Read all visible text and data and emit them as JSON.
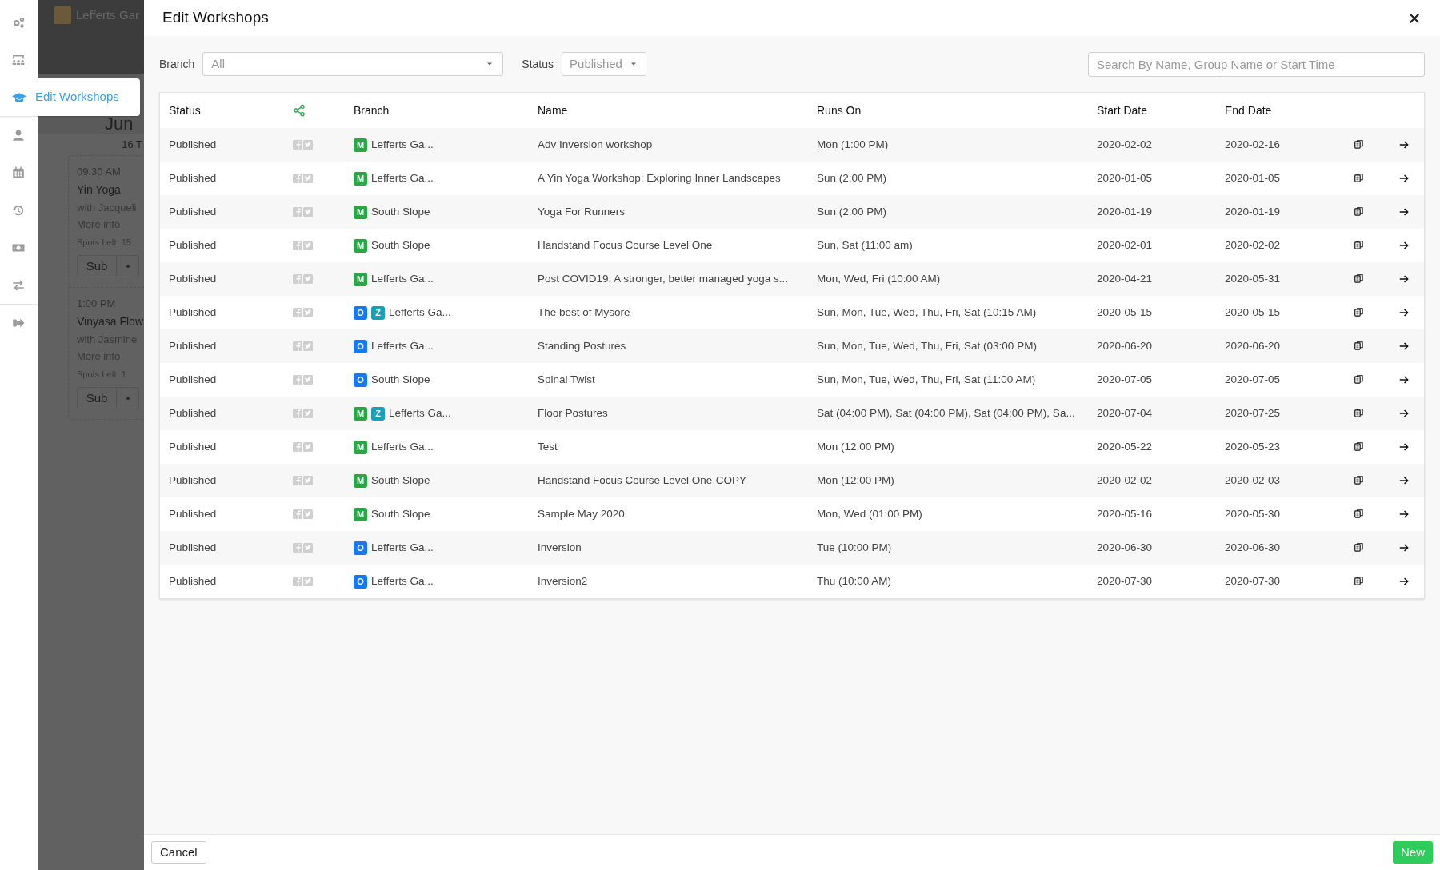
{
  "sidebar": {
    "items": [
      {
        "selected": false
      },
      {
        "selected": false
      },
      {
        "selected": true,
        "label": "Edit Workshops"
      },
      {
        "selected": false
      },
      {
        "selected": false
      },
      {
        "selected": false
      },
      {
        "selected": false
      },
      {
        "selected": false
      },
      {
        "selected": false
      }
    ]
  },
  "background_page": {
    "brand": "Lefferts Gar",
    "heading": "Jun",
    "day": "16 T",
    "classes": [
      {
        "time": "09:30 AM",
        "title": "Yin Yoga",
        "teacher": "with Jacqueli",
        "link": "More info",
        "spots": "Spots Left: 15",
        "button": "Sub"
      },
      {
        "time": "1:00 PM",
        "title": "Vinyasa Flow",
        "teacher": "with Jasmine",
        "link": "More info",
        "spots": "Spots Left: 1",
        "button": "Sub"
      }
    ]
  },
  "modal": {
    "title": "Edit Workshops",
    "filters": {
      "branch": {
        "label": "Branch",
        "value": "All"
      },
      "status": {
        "label": "Status",
        "value": "Published"
      },
      "search": {
        "placeholder": "Search By Name, Group Name or Start Time"
      }
    },
    "table": {
      "columns": [
        "Status",
        "Branch",
        "Name",
        "Runs On",
        "Start Date",
        "End Date"
      ],
      "rows": [
        {
          "status": "Published",
          "tags": [
            {
              "letter": "M",
              "color": "#28a745"
            }
          ],
          "branch": "Lefferts Ga...",
          "name": "Adv Inversion workshop",
          "runs_on": "Mon (1:00 PM)",
          "start_date": "2020-02-02",
          "end_date": "2020-02-16"
        },
        {
          "status": "Published",
          "tags": [
            {
              "letter": "M",
              "color": "#28a745"
            }
          ],
          "branch": "Lefferts Ga...",
          "name": "A Yin Yoga Workshop: Exploring Inner Landscapes",
          "runs_on": "Sun (2:00 PM)",
          "start_date": "2020-01-05",
          "end_date": "2020-01-05"
        },
        {
          "status": "Published",
          "tags": [
            {
              "letter": "M",
              "color": "#28a745"
            }
          ],
          "branch": "South Slope",
          "name": "Yoga For Runners",
          "runs_on": "Sun (2:00 PM)",
          "start_date": "2020-01-19",
          "end_date": "2020-01-19"
        },
        {
          "status": "Published",
          "tags": [
            {
              "letter": "M",
              "color": "#28a745"
            }
          ],
          "branch": "South Slope",
          "name": "Handstand Focus Course Level One",
          "runs_on": "Sun, Sat (11:00 am)",
          "start_date": "2020-02-01",
          "end_date": "2020-02-02"
        },
        {
          "status": "Published",
          "tags": [
            {
              "letter": "M",
              "color": "#28a745"
            }
          ],
          "branch": "Lefferts Ga...",
          "name": "Post COVID19: A stronger, better managed yoga s...",
          "runs_on": "Mon, Wed, Fri (10:00 AM)",
          "start_date": "2020-04-21",
          "end_date": "2020-05-31"
        },
        {
          "status": "Published",
          "tags": [
            {
              "letter": "O",
              "color": "#1479f5"
            },
            {
              "letter": "Z",
              "color": "#1a9fb8"
            }
          ],
          "branch": "Lefferts Ga...",
          "name": "The best of Mysore",
          "runs_on": "Sun, Mon, Tue, Wed, Thu, Fri, Sat (10:15 AM)",
          "start_date": "2020-05-15",
          "end_date": "2020-05-15"
        },
        {
          "status": "Published",
          "tags": [
            {
              "letter": "O",
              "color": "#1479f5"
            }
          ],
          "branch": "Lefferts Ga...",
          "name": "Standing Postures",
          "runs_on": "Sun, Mon, Tue, Wed, Thu, Fri, Sat (03:00 PM)",
          "start_date": "2020-06-20",
          "end_date": "2020-06-20"
        },
        {
          "status": "Published",
          "tags": [
            {
              "letter": "O",
              "color": "#1479f5"
            }
          ],
          "branch": "South Slope",
          "name": "Spinal Twist",
          "runs_on": "Sun, Mon, Tue, Wed, Thu, Fri, Sat (11:00 AM)",
          "start_date": "2020-07-05",
          "end_date": "2020-07-05"
        },
        {
          "status": "Published",
          "tags": [
            {
              "letter": "M",
              "color": "#28a745"
            },
            {
              "letter": "Z",
              "color": "#1a9fb8"
            }
          ],
          "branch": "Lefferts Ga...",
          "name": "Floor Postures",
          "runs_on": "Sat (04:00 PM), Sat (04:00 PM), Sat (04:00 PM), Sa...",
          "start_date": "2020-07-04",
          "end_date": "2020-07-25"
        },
        {
          "status": "Published",
          "tags": [
            {
              "letter": "M",
              "color": "#28a745"
            }
          ],
          "branch": "Lefferts Ga...",
          "name": "Test",
          "runs_on": "Mon (12:00 PM)",
          "start_date": "2020-05-22",
          "end_date": "2020-05-23"
        },
        {
          "status": "Published",
          "tags": [
            {
              "letter": "M",
              "color": "#28a745"
            }
          ],
          "branch": "South Slope",
          "name": "Handstand Focus Course Level One-COPY",
          "runs_on": "Mon (12:00 PM)",
          "start_date": "2020-02-02",
          "end_date": "2020-02-03"
        },
        {
          "status": "Published",
          "tags": [
            {
              "letter": "M",
              "color": "#28a745"
            }
          ],
          "branch": "South Slope",
          "name": "Sample May 2020",
          "runs_on": "Mon, Wed (01:00 PM)",
          "start_date": "2020-05-16",
          "end_date": "2020-05-30"
        },
        {
          "status": "Published",
          "tags": [
            {
              "letter": "O",
              "color": "#1479f5"
            }
          ],
          "branch": "Lefferts Ga...",
          "name": "Inversion",
          "runs_on": "Tue (10:00 PM)",
          "start_date": "2020-06-30",
          "end_date": "2020-06-30"
        },
        {
          "status": "Published",
          "tags": [
            {
              "letter": "O",
              "color": "#1479f5"
            }
          ],
          "branch": "Lefferts Ga...",
          "name": "Inversion2",
          "runs_on": "Thu (10:00 AM)",
          "start_date": "2020-07-30",
          "end_date": "2020-07-30"
        }
      ]
    },
    "footer": {
      "cancel": "Cancel",
      "new": "New"
    }
  }
}
